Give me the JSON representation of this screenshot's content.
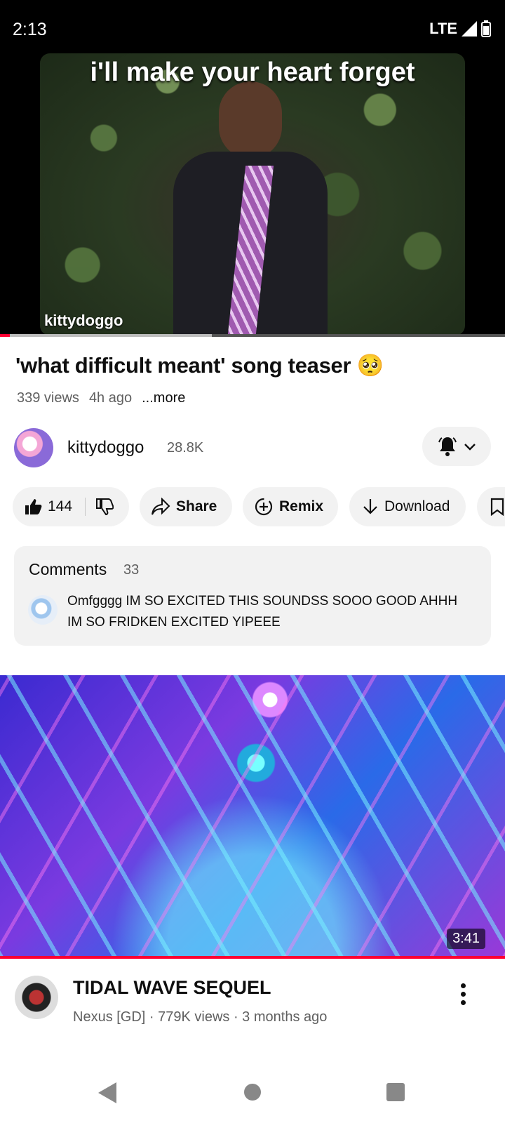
{
  "status_bar": {
    "time": "2:13",
    "network": "LTE"
  },
  "player": {
    "caption": "i'll make your heart forget",
    "watermark": "kittydoggo",
    "progress_played": 0.02,
    "progress_buffered": 0.42
  },
  "video": {
    "title": "'what difficult meant' song teaser 🥺",
    "views": "339 views",
    "age": "4h ago",
    "more_label": "...more"
  },
  "channel": {
    "name": "kittydoggo",
    "subscribers": "28.8K"
  },
  "actions": {
    "like_count": "144",
    "share_label": "Share",
    "remix_label": "Remix",
    "download_label": "Download"
  },
  "comments": {
    "title": "Comments",
    "count": "33",
    "top_comment": "Omfgggg IM SO EXCITED THIS SOUNDSS SOOO GOOD AHHH IM SO FRIDKEN EXCITED YIPEEE"
  },
  "next_video": {
    "duration": "3:41",
    "title": "TIDAL WAVE SEQUEL",
    "meta": "Nexus [GD] · 779K views · 3 months ago"
  },
  "colors": {
    "accent": "#ff0033",
    "pill_bg": "#f2f2f2",
    "secondary_text": "#606060"
  },
  "icons": [
    "signal-icon",
    "battery-icon",
    "bell-icon",
    "chevron-down-icon",
    "thumbs-up-icon",
    "thumbs-down-icon",
    "share-icon",
    "remix-icon",
    "download-icon",
    "bookmark-icon",
    "more-vert-icon",
    "back-icon",
    "home-icon",
    "recents-icon"
  ]
}
